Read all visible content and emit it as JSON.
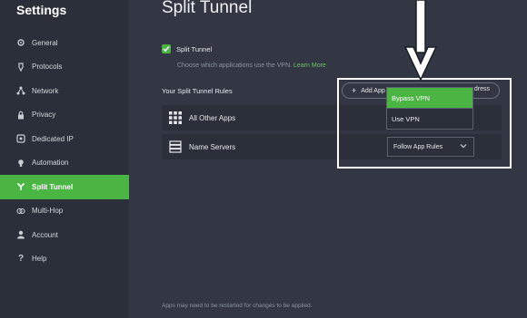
{
  "sidebar": {
    "title": "Settings",
    "items": [
      {
        "label": "General",
        "icon": "gear-icon",
        "active": false
      },
      {
        "label": "Protocols",
        "icon": "protocols-icon",
        "active": false
      },
      {
        "label": "Network",
        "icon": "network-icon",
        "active": false
      },
      {
        "label": "Privacy",
        "icon": "lock-icon",
        "active": false
      },
      {
        "label": "Dedicated IP",
        "icon": "dedicated-ip-icon",
        "active": false
      },
      {
        "label": "Automation",
        "icon": "bulb-icon",
        "active": false
      },
      {
        "label": "Split Tunnel",
        "icon": "split-icon",
        "active": true
      },
      {
        "label": "Multi-Hop",
        "icon": "multihop-icon",
        "active": false
      },
      {
        "label": "Account",
        "icon": "user-icon",
        "active": false
      },
      {
        "label": "Help",
        "icon": "question-icon",
        "active": false
      }
    ]
  },
  "main": {
    "title": "Split Tunnel",
    "checkbox_label": "Split Tunnel",
    "checkbox_checked": true,
    "description": "Choose which applications use the VPN.",
    "learn_more": "Learn More",
    "rules_label": "Your Split Tunnel Rules",
    "add_app_label": "Add App",
    "add_ip_tail": "dress",
    "rows": [
      {
        "label": "All Other Apps",
        "icon": "grid-icon"
      },
      {
        "label": "Name Servers",
        "icon": "server-icon",
        "select_value": "Follow App Rules"
      }
    ],
    "dropdown": {
      "options": [
        "Bypass VPN",
        "Use VPN"
      ],
      "selected": "Bypass VPN"
    },
    "footer": "Apps may need to be restarted for changes to be applied."
  },
  "colors": {
    "accent": "#4bb543",
    "background": "#323743",
    "sidebar": "#2a2f39"
  }
}
